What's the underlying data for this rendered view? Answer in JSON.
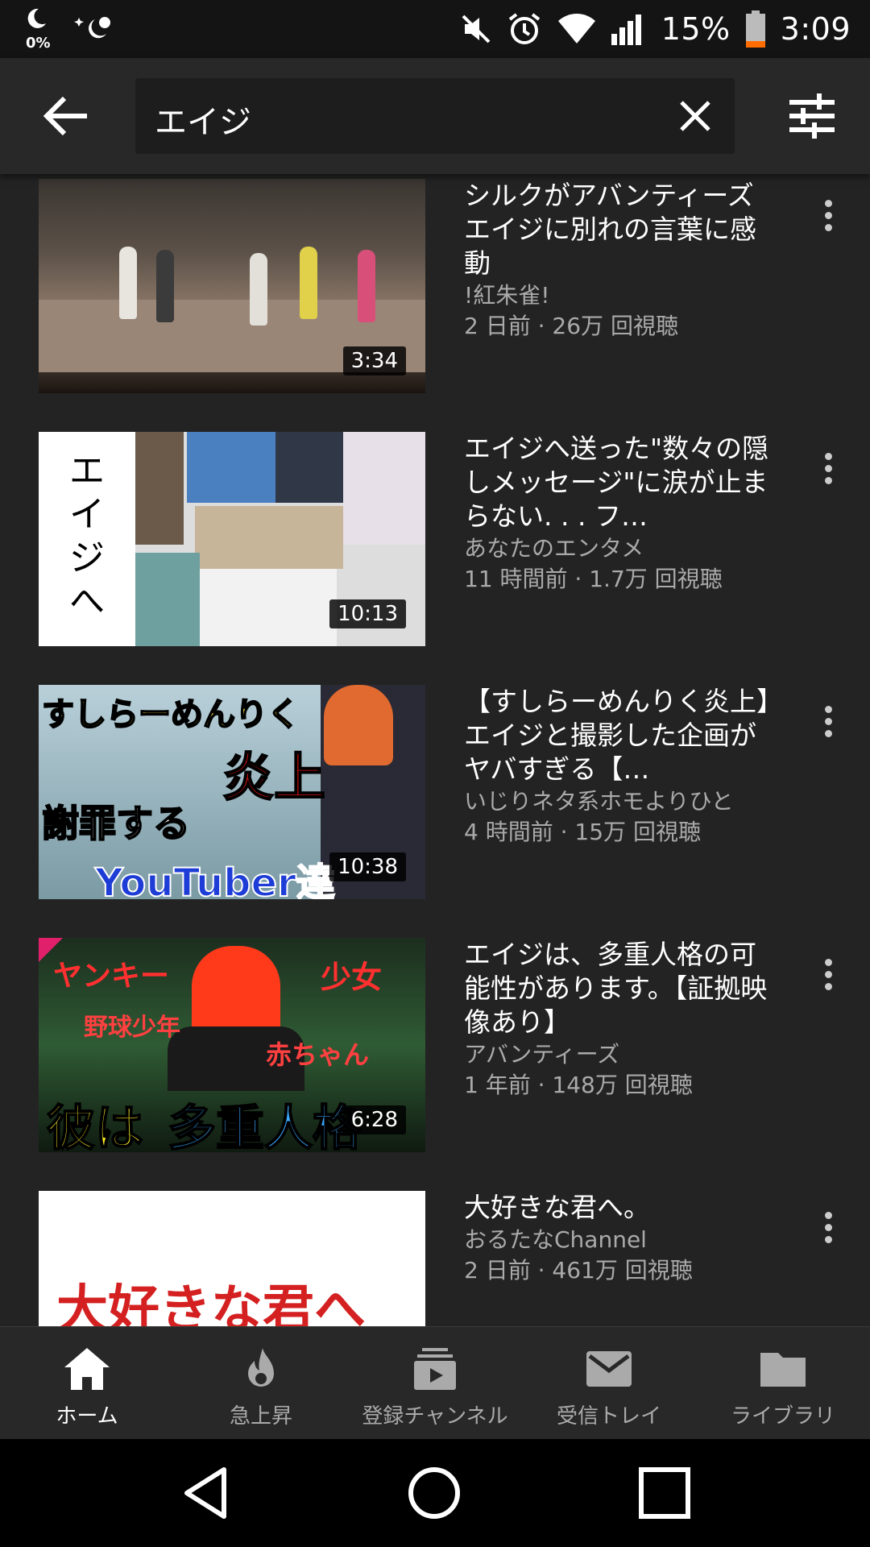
{
  "status_bar": {
    "dnd_percent": "0%",
    "battery_percent": "15%",
    "time": "3:09",
    "icons": [
      "moon-icon",
      "weather-night-icon",
      "mute-icon",
      "alarm-icon",
      "wifi-icon",
      "signal-icon",
      "battery-icon"
    ]
  },
  "search": {
    "query": "エイジ",
    "back_icon": "back-arrow-icon",
    "clear_icon": "close-icon",
    "filter_icon": "filter-sliders-icon"
  },
  "videos": [
    {
      "title": "シルクがアバンティーズエイジに別れの言葉に感動",
      "channel": "!紅朱雀!",
      "stats": "2 日前 · 26万 回視聴",
      "duration": "3:34"
    },
    {
      "title": "エイジへ送った\"数々の隠しメッセージ\"に涙が止まらない. . . フ…",
      "channel": "あなたのエンタメ",
      "stats": "11 時間前 · 1.7万 回視聴",
      "duration": "10:13",
      "thumb_text": [
        "エ",
        "イ",
        "ジ",
        "へ"
      ]
    },
    {
      "title": "【すしらーめんりく炎上】エイジと撮影した企画がヤバすぎる【…",
      "channel": "いじりネタ系ホモよりひと",
      "stats": "4 時間前 · 15万 回視聴",
      "duration": "10:38",
      "thumb_text": [
        "すしらーめんりく",
        "炎上",
        "謝罪する",
        "YouTuber達"
      ]
    },
    {
      "title": "エイジは、多重人格の可能性があります。【証拠映像あり】",
      "channel": "アバンティーズ",
      "stats": "1 年前 · 148万 回視聴",
      "duration": "6:28",
      "thumb_text": [
        "ヤンキー",
        "少女",
        "野球少年",
        "赤ちゃん",
        "彼は",
        "多重人格"
      ]
    },
    {
      "title": "大好きな君へ。",
      "channel": "おるたなChannel",
      "stats": "2 日前 · 461万 回視聴",
      "thumb_text": [
        "大好きな君へ"
      ]
    }
  ],
  "bottom_nav": [
    {
      "label": "ホーム",
      "icon": "home-icon",
      "active": true
    },
    {
      "label": "急上昇",
      "icon": "flame-icon",
      "active": false
    },
    {
      "label": "登録チャンネル",
      "icon": "subscriptions-icon",
      "active": false
    },
    {
      "label": "受信トレイ",
      "icon": "inbox-mail-icon",
      "active": false
    },
    {
      "label": "ライブラリ",
      "icon": "library-folder-icon",
      "active": false
    }
  ],
  "system_nav": [
    "back-triangle-icon",
    "home-circle-icon",
    "recents-square-icon"
  ],
  "colors": {
    "background": "#232323",
    "header": "#282828",
    "search_box": "#1d1d1d",
    "secondary_text": "#aaaaaa",
    "battery_low": "#ff6d00"
  }
}
